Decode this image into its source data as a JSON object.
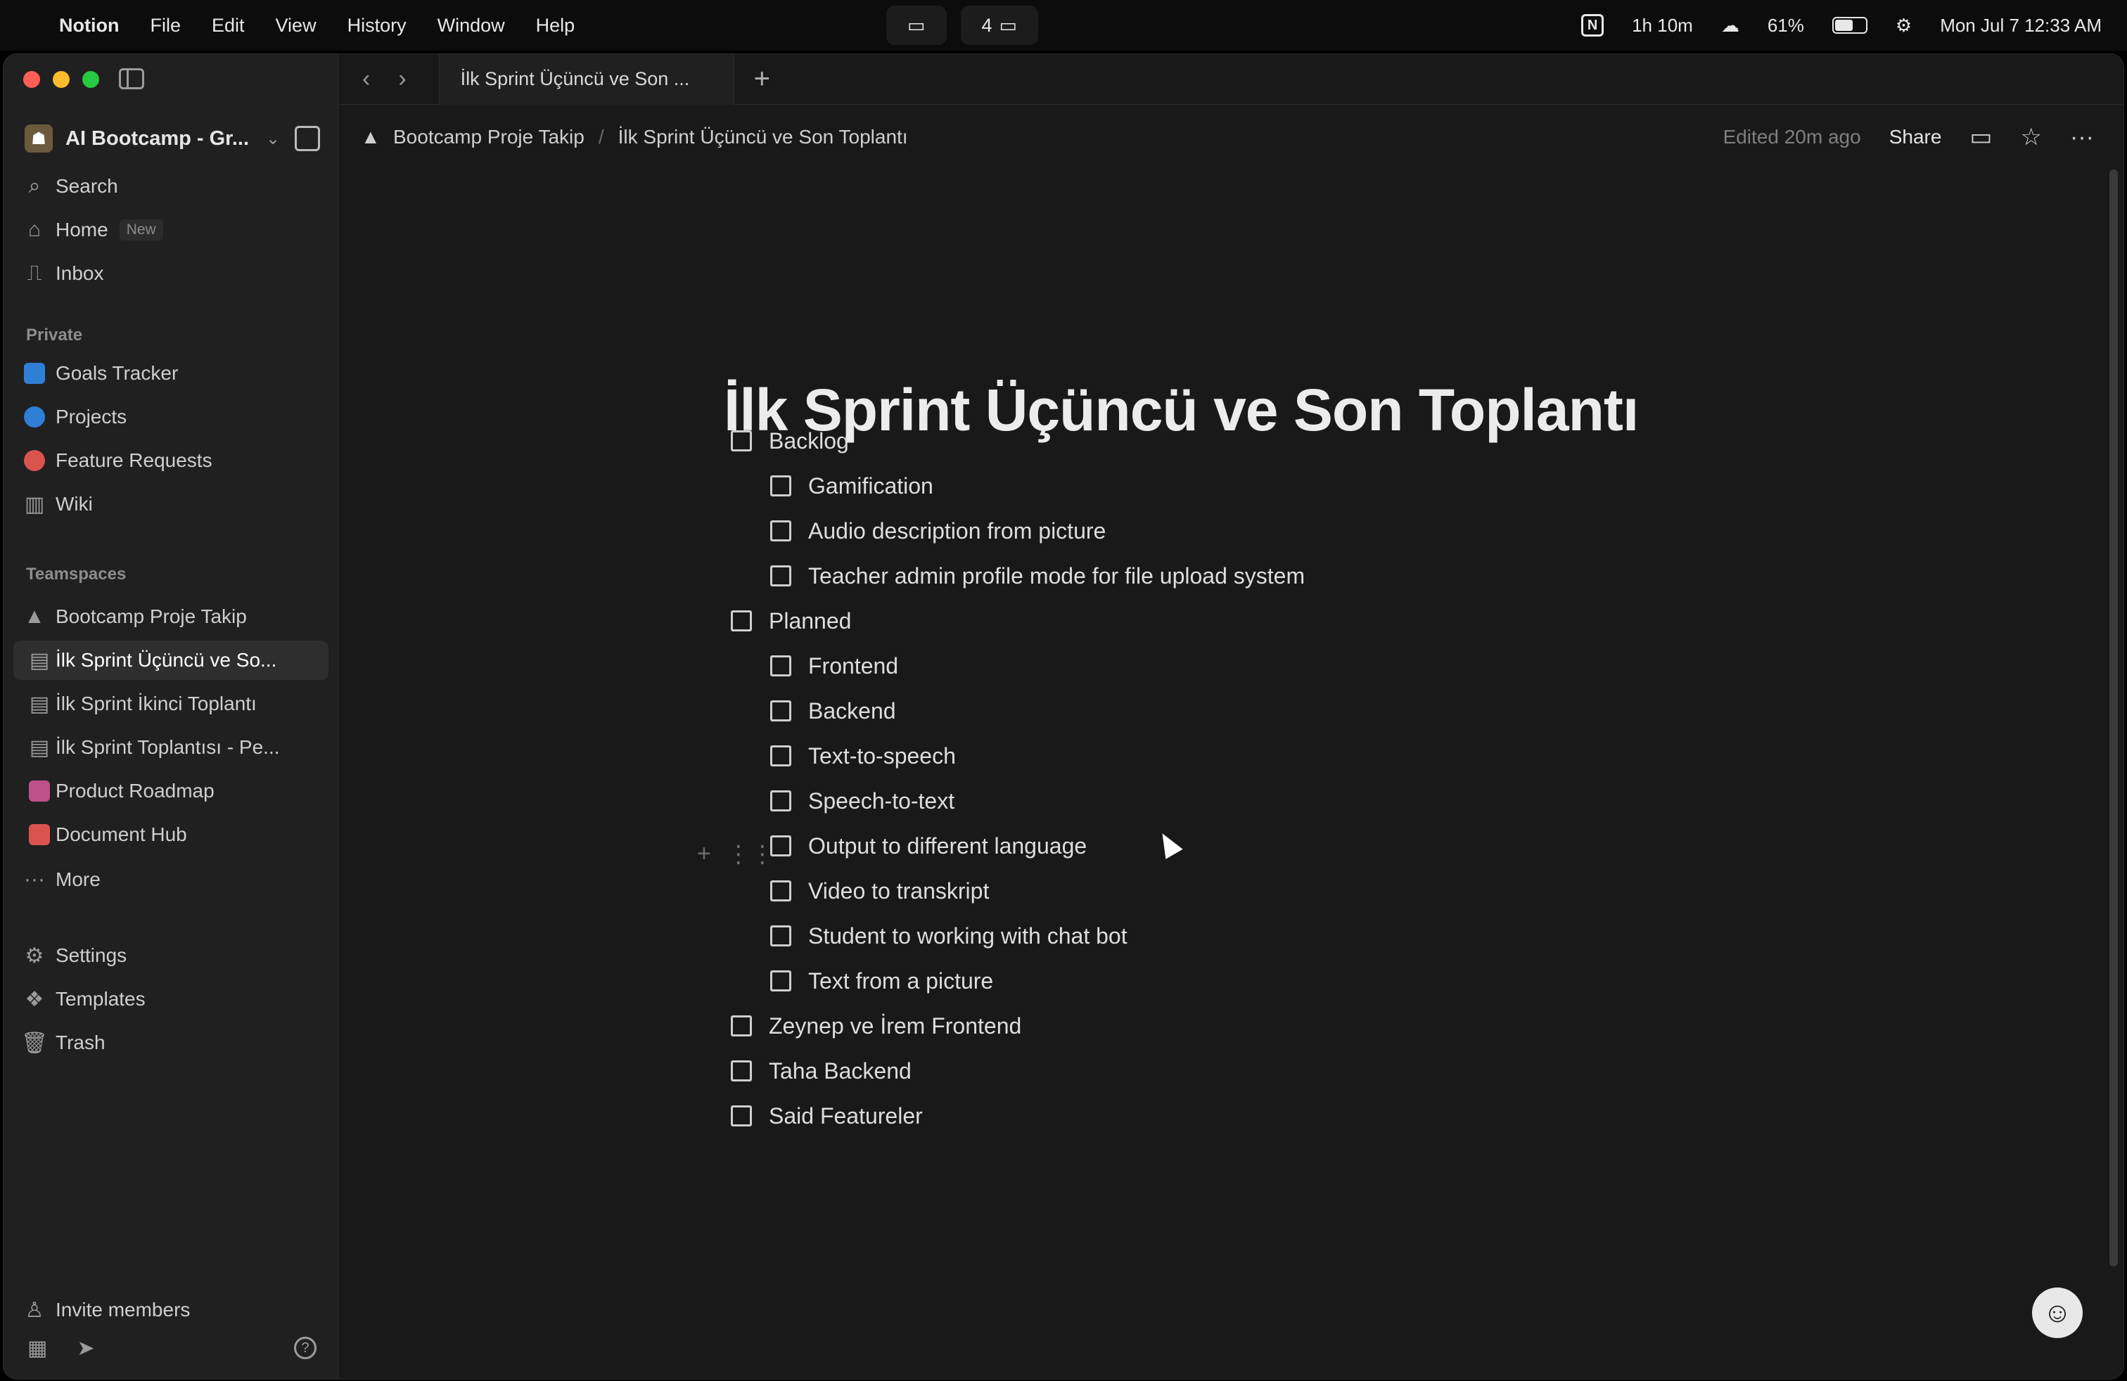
{
  "menubar": {
    "app": "Notion",
    "menus": [
      "File",
      "Edit",
      "View",
      "History",
      "Window",
      "Help"
    ],
    "center_count": "4",
    "timer": "1h 10m",
    "battery": "61%",
    "datetime": "Mon Jul 7  12:33 AM"
  },
  "sidebar": {
    "workspace": "AI Bootcamp - Gr...",
    "search": "Search",
    "home": "Home",
    "home_badge": "New",
    "inbox": "Inbox",
    "private_label": "Private",
    "private_items": [
      "Goals Tracker",
      "Projects",
      "Feature Requests",
      "Wiki"
    ],
    "teamspaces_label": "Teamspaces",
    "teamspace": "Bootcamp Proje Takip",
    "pages": [
      "İlk Sprint Üçüncü ve So...",
      "İlk Sprint İkinci Toplantı",
      "İlk Sprint Toplantısı - Pe...",
      "Product Roadmap",
      "Document Hub"
    ],
    "more": "More",
    "settings": "Settings",
    "templates": "Templates",
    "trash": "Trash",
    "invite": "Invite members"
  },
  "tabbar": {
    "tab_title": "İlk Sprint Üçüncü ve Son ..."
  },
  "breadcrumb": {
    "parent": "Bootcamp Proje Takip",
    "current": "İlk Sprint Üçüncü ve Son Toplantı"
  },
  "actions": {
    "edited": "Edited 20m ago",
    "share": "Share"
  },
  "page": {
    "title": "İlk Sprint Üçüncü ve Son Toplantı",
    "todos": [
      "Backlog",
      "Gamification",
      "Audio description from picture",
      "Teacher admin profile mode for file upload system",
      "Planned",
      "Frontend",
      "Backend",
      "Text-to-speech",
      "Speech-to-text",
      "Output to different language",
      "Video to transkript",
      "Student to working with chat bot",
      "Text from a picture",
      "Zeynep ve İrem Frontend",
      "Taha Backend",
      "Said Featureler"
    ]
  },
  "colors": {
    "background": "#191919",
    "sidebar": "#202020",
    "goals": "#2f7fd6",
    "projects": "#2f7fd6",
    "feature_requests": "#d9534f",
    "product_roadmap": "#c0508a",
    "document_hub": "#d9534f"
  }
}
